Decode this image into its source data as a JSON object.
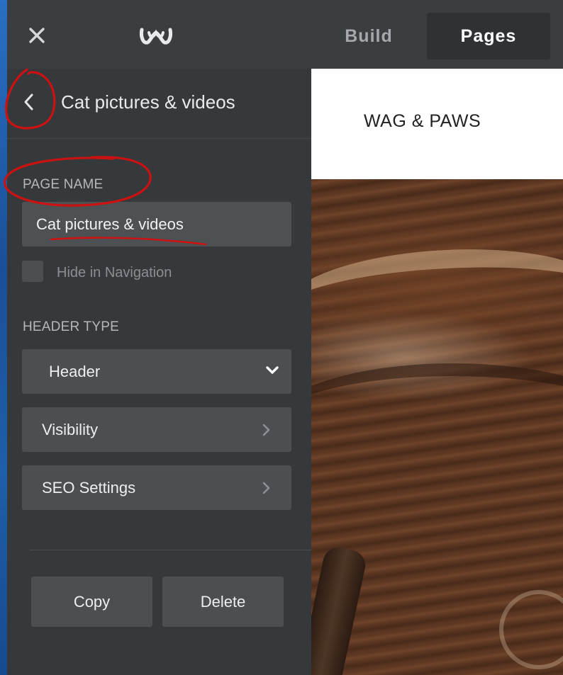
{
  "topbar": {
    "close_icon": "close-icon",
    "logo_icon": "weebly-logo-icon",
    "tabs": [
      {
        "label": "Build",
        "active": false
      },
      {
        "label": "Pages",
        "active": true
      }
    ]
  },
  "sidebar": {
    "back_icon": "chevron-left-icon",
    "title": "Cat pictures & videos",
    "page_name_label": "PAGE NAME",
    "page_name_value": "Cat pictures & videos",
    "hide_in_nav_label": "Hide in Navigation",
    "hide_in_nav_checked": false,
    "header_type_label": "HEADER TYPE",
    "header_type_value": "Header",
    "visibility_label": "Visibility",
    "seo_label": "SEO Settings",
    "copy_label": "Copy",
    "delete_label": "Delete"
  },
  "preview": {
    "site_title": "WAG & PAWS"
  },
  "colors": {
    "annotation": "#cc1111",
    "panel": "#36393c",
    "topbar": "#3a3e41"
  }
}
